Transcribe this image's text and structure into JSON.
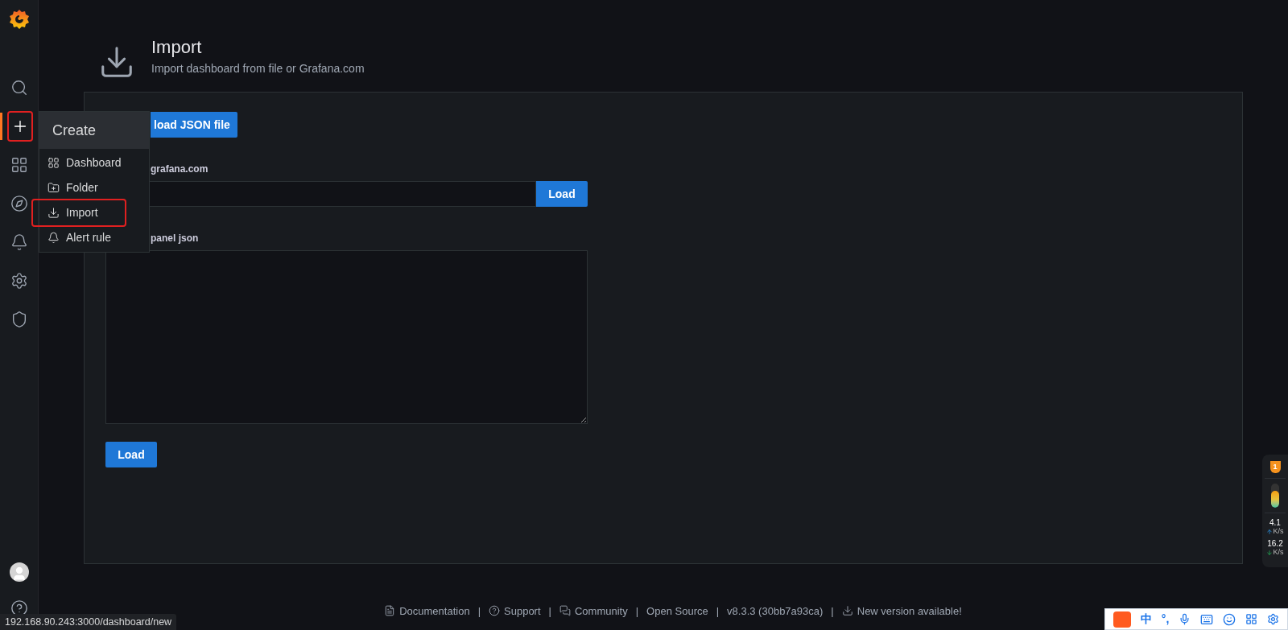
{
  "sidebar": {
    "top": [
      {
        "kind": "search",
        "selected": false,
        "highlighted": false
      },
      {
        "kind": "create",
        "selected": true,
        "highlighted": true
      },
      {
        "kind": "dashboards",
        "selected": false,
        "highlighted": false
      },
      {
        "kind": "explore",
        "selected": false,
        "highlighted": false
      },
      {
        "kind": "alerting",
        "selected": false,
        "highlighted": false
      },
      {
        "kind": "configuration",
        "selected": false,
        "highlighted": false
      },
      {
        "kind": "admin",
        "selected": false,
        "highlighted": false
      }
    ],
    "bottom": [
      {
        "kind": "profile"
      },
      {
        "kind": "help"
      }
    ]
  },
  "create_menu": {
    "title": "Create",
    "items": [
      {
        "label": "Dashboard",
        "kind": "dashboard",
        "highlighted": false
      },
      {
        "label": "Folder",
        "kind": "folder",
        "highlighted": false
      },
      {
        "label": "Import",
        "kind": "import",
        "highlighted": true
      },
      {
        "label": "Alert rule",
        "kind": "alert",
        "highlighted": false
      }
    ]
  },
  "header": {
    "title": "Import",
    "subtitle": "Import dashboard from file or Grafana.com"
  },
  "upload_button": "load JSON file",
  "grafana_label": "grafana.com",
  "grafana_load_button": "Load",
  "panel_json_label": "panel json",
  "panel_load_button": "Load",
  "footer": [
    {
      "kind": "docs",
      "label": "Documentation"
    },
    {
      "kind": "separator",
      "label": "|"
    },
    {
      "kind": "support",
      "label": "Support"
    },
    {
      "kind": "separator",
      "label": "|"
    },
    {
      "kind": "community",
      "label": "Community"
    },
    {
      "kind": "separator",
      "label": "|"
    },
    {
      "kind": "link",
      "label": "Open Source"
    },
    {
      "kind": "separator",
      "label": "|"
    },
    {
      "kind": "version",
      "label": "v8.3.3 (30bb7a93ca)"
    },
    {
      "kind": "separator",
      "label": "|"
    },
    {
      "kind": "update",
      "label": "New version available!"
    }
  ],
  "status_url": "192.168.90.243:3000/dashboard/new",
  "net_widget": {
    "badge": "1",
    "level": 0.7,
    "up": {
      "value": "4.1",
      "unit": "K/s"
    },
    "down": {
      "value": "16.2",
      "unit": "K/s"
    }
  },
  "ime_bar": {
    "items": [
      {
        "kind": "logo"
      },
      {
        "kind": "text",
        "label": "中"
      },
      {
        "kind": "text",
        "label": "°,"
      },
      {
        "kind": "mic"
      },
      {
        "kind": "keyboard"
      },
      {
        "kind": "emoji"
      },
      {
        "kind": "grid"
      },
      {
        "kind": "gear"
      }
    ]
  }
}
